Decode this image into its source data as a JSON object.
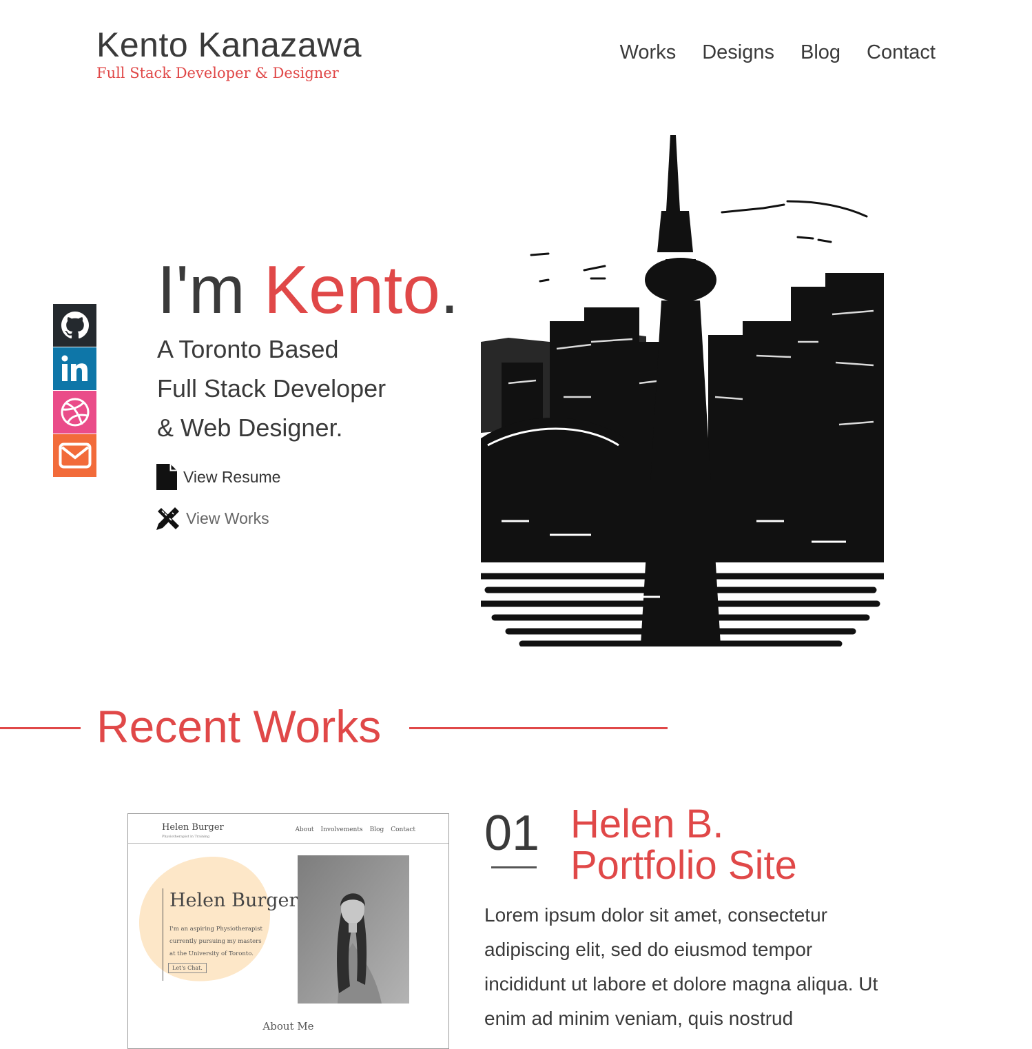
{
  "header": {
    "name": "Kento Kanazawa",
    "tagline": "Full Stack Developer & Designer",
    "nav": [
      "Works",
      "Designs",
      "Blog",
      "Contact"
    ]
  },
  "social": [
    {
      "icon": "github-icon",
      "color": "#24292e"
    },
    {
      "icon": "linkedin-icon",
      "color": "#0e76a8"
    },
    {
      "icon": "dribbble-icon",
      "color": "#ea4c89"
    },
    {
      "icon": "email-icon",
      "color": "#f26b3a"
    }
  ],
  "hero": {
    "greeting": "I'm ",
    "name": "Kento",
    "period": ".",
    "lines": [
      "A Toronto Based",
      "Full Stack Developer",
      "& Web Designer."
    ],
    "resume_link": "View Resume",
    "works_link": "View Works"
  },
  "section": {
    "title": "Recent Works"
  },
  "project": {
    "number": "01",
    "title_line1": "Helen B.",
    "title_line2": "Portfolio Site",
    "description": "Lorem ipsum dolor sit amet, consectetur adipiscing elit, sed do eiusmod tempor incididunt ut labore et dolore magna aliqua. Ut enim ad minim veniam, quis nostrud",
    "preview": {
      "name": "Helen Burger",
      "subtitle": "Physiotherapist in Training",
      "nav": [
        "About",
        "Involvements",
        "Blog",
        "Contact"
      ],
      "hero_name": "Helen Burger",
      "intro": "I'm an aspiring Physiotherapist currently pursuing my masters at the University of Toronto.",
      "button": "Let's Chat.",
      "about_heading": "About Me"
    }
  },
  "colors": {
    "accent": "#e04848",
    "text": "#3a3a3a"
  }
}
